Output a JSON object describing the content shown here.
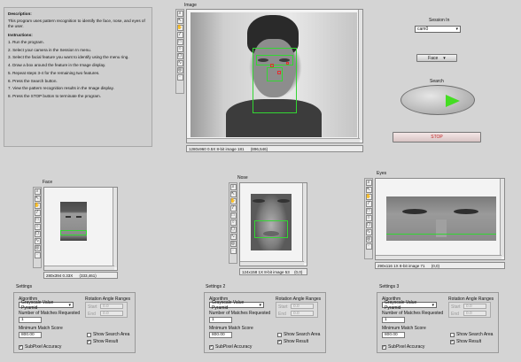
{
  "description": {
    "title": "Description:",
    "text": "This program uses pattern recognition to identify the face, nose, and eyes of the user.",
    "instructions_title": "Instructions:",
    "steps": [
      "1. Run the program.",
      "2. Select your camera in the Session In menu.",
      "3. Select the facial feature you want to identify using the menu ring.",
      "4. Draw a box around the feature in the Image display.",
      "5. Repeat steps 3-4 for the remaining two features.",
      "6. Press the Search button.",
      "7. View the pattern recognition results in the Image display.",
      "8. Press the STOP button to terminate the program."
    ]
  },
  "main_image": {
    "label": "Image",
    "status": "1280x960 0.5X 8-bit image 181",
    "coords": "(896,546)"
  },
  "session": {
    "label": "Session In",
    "value": "cam0",
    "feature_value": "Face",
    "search_label": "Search",
    "stop_label": "STOP"
  },
  "face": {
    "label": "Face",
    "status": "280x394 0.33X",
    "coords": "(333,461)"
  },
  "nose": {
    "label": "Nose",
    "status": "124x158 1X 8-bit image 53",
    "coords": "(0,0)"
  },
  "eyes": {
    "label": "Eyes",
    "status": "290x116 1X 8-bit image 71",
    "coords": "(0,0)"
  },
  "settings": [
    {
      "label": "Settings",
      "algorithm_label": "Algorithm",
      "algorithm_value": "Grayscale Value Pyramid",
      "rotation_label": "Rotation Angle Ranges",
      "start_label": "Start",
      "start_value": "0.0",
      "end_label": "End",
      "end_value": "0.0",
      "matches_label": "Number of Matches Requested",
      "matches_value": "1",
      "min_score_label": "Minimum Match Score",
      "min_score_value": "800.00",
      "show_search_label": "Show Search Area",
      "show_result_label": "Show Result",
      "subpixel_label": "SubPixel Accuracy"
    },
    {
      "label": "Settings 2",
      "algorithm_label": "Algorithm",
      "algorithm_value": "Grayscale Value Pyramid",
      "rotation_label": "Rotation Angle Ranges",
      "start_label": "Start",
      "start_value": "0.0",
      "end_label": "End",
      "end_value": "0.0",
      "matches_label": "Number of Matches Requested",
      "matches_value": "1",
      "min_score_label": "Minimum Match Score",
      "min_score_value": "800.00",
      "show_search_label": "Show Search Area",
      "show_result_label": "Show Result",
      "subpixel_label": "SubPixel Accuracy"
    },
    {
      "label": "Settings 3",
      "algorithm_label": "Algorithm",
      "algorithm_value": "Grayscale Value Pyramid",
      "rotation_label": "Rotation Angle Ranges",
      "start_label": "Start",
      "start_value": "0.0",
      "end_label": "End",
      "end_value": "0.0",
      "matches_label": "Number of Matches Requested",
      "matches_value": "1",
      "min_score_label": "Minimum Match Score",
      "min_score_value": "800.00",
      "show_search_label": "Show Search Area",
      "show_result_label": "Show Result",
      "subpixel_label": "SubPixel Accuracy"
    }
  ],
  "colors": {
    "background": "#d4d4d4",
    "match_box": "#33d633",
    "feature_points": "#e03030",
    "search_led": "#44dd22",
    "stop_text": "#c02020"
  },
  "icons": [
    "zoom-icon",
    "pointer-icon",
    "hand-icon",
    "line-icon",
    "rectangle-icon",
    "oval-icon",
    "polygon-icon",
    "freehand-icon"
  ]
}
